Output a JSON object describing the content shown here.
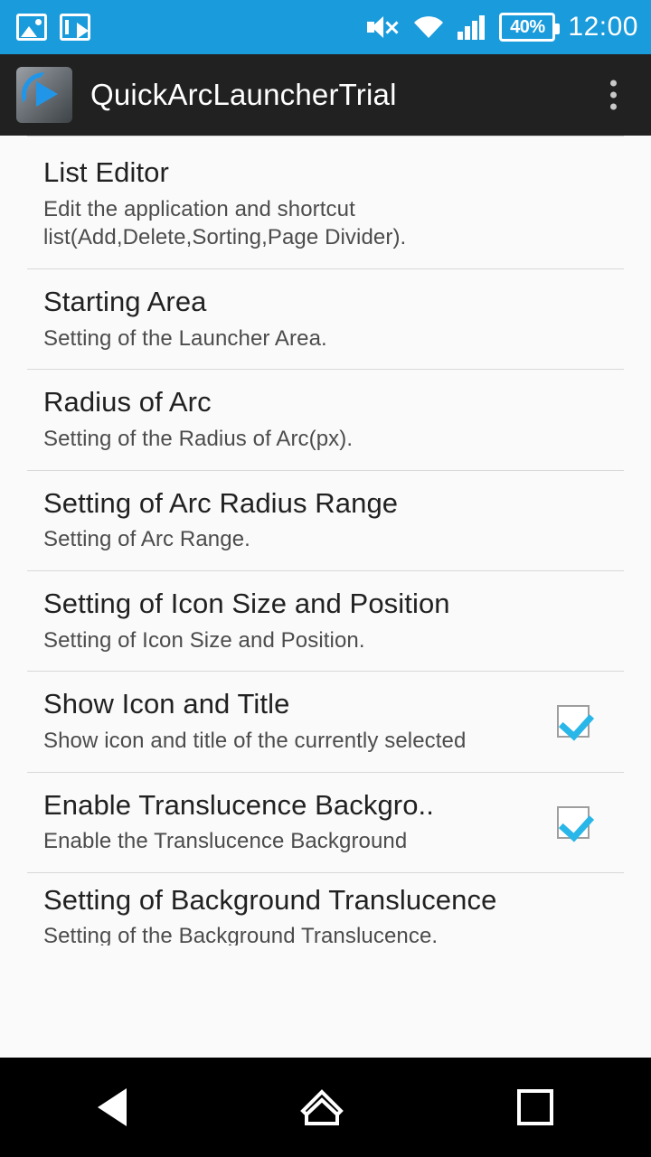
{
  "statusbar": {
    "clock": "12:00",
    "battery_level": "40%",
    "left_icons": [
      "image-icon",
      "image-transfer-icon"
    ],
    "right_icons": [
      "volume-mute-icon",
      "wifi-icon",
      "cellular-signal-icon",
      "battery-icon"
    ]
  },
  "actionbar": {
    "app_icon": "quickarclauncher-logo",
    "title": "QuickArcLauncherTrial",
    "overflow": "overflow-menu-icon"
  },
  "list": {
    "items": [
      {
        "title": "List Editor",
        "subtitle": "Edit the application and shortcut list(Add,Delete,Sorting,Page Divider).",
        "has_checkbox": false,
        "checked": false
      },
      {
        "title": "Starting Area",
        "subtitle": "Setting of the Launcher Area.",
        "has_checkbox": false,
        "checked": false
      },
      {
        "title": "Radius of Arc",
        "subtitle": "Setting of the Radius of Arc(px).",
        "has_checkbox": false,
        "checked": false
      },
      {
        "title": "Setting of Arc Radius Range",
        "subtitle": "Setting of Arc Range.",
        "has_checkbox": false,
        "checked": false
      },
      {
        "title": "Setting of Icon Size and Position",
        "subtitle": "Setting of Icon Size and Position.",
        "has_checkbox": false,
        "checked": false
      },
      {
        "title": "Show Icon and Title",
        "subtitle": "Show icon and title of the currently selected",
        "has_checkbox": true,
        "checked": true
      },
      {
        "title": "Enable Translucence Backgro..",
        "subtitle": "Enable the Translucence Background",
        "has_checkbox": true,
        "checked": true
      },
      {
        "title": "Setting of Background Translucence",
        "subtitle": "Setting of the Background Translucence.",
        "has_checkbox": false,
        "checked": false
      }
    ]
  },
  "navbar": {
    "back": "back-nav-icon",
    "home": "home-nav-icon",
    "recents": "recents-nav-icon"
  },
  "colors": {
    "status_bar": "#1a9bdc",
    "action_bar": "#212121",
    "accent": "#29b6e8",
    "list_bg": "#fafafa"
  }
}
